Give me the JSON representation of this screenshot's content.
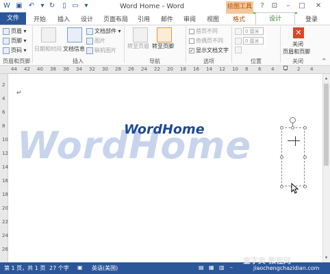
{
  "title": "Word Home - Word",
  "contextual_label": "绘图工具",
  "qat": {
    "save": "save-icon",
    "undo": "undo-icon",
    "redo": "redo-icon"
  },
  "tabs": [
    {
      "label": "文件"
    },
    {
      "label": "开始"
    },
    {
      "label": "插入"
    },
    {
      "label": "设计"
    },
    {
      "label": "页面布局"
    },
    {
      "label": "引用"
    },
    {
      "label": "邮件"
    },
    {
      "label": "审阅"
    },
    {
      "label": "视图"
    },
    {
      "label": "格式"
    },
    {
      "label": "设计"
    }
  ],
  "login": "登录",
  "ribbon": {
    "header_footer": {
      "header": "页眉",
      "footer": "页脚",
      "pagenum": "页码",
      "group": "页眉和页脚"
    },
    "insert": {
      "datetime": "日期和时间",
      "docinfo": "文档信息",
      "docparts": "文档部件",
      "picture": "图片",
      "online": "联机图片",
      "group": "插入"
    },
    "nav": {
      "goto_header": "转至页眉",
      "goto_footer": "转至页脚",
      "group": "导航"
    },
    "options": {
      "diff_first": "首页不同",
      "diff_odd": "奇偶页不同",
      "show_text": "显示文档文字",
      "group": "选项"
    },
    "position": {
      "top_val": "0 厘米",
      "bottom_val": "0 厘米",
      "group": "位置"
    },
    "close": {
      "label_line1": "关闭",
      "label_line2": "页眉和页脚",
      "group": "关闭"
    }
  },
  "ruler_ticks": [
    "44",
    "42",
    "40",
    "38",
    "36",
    "34",
    "32",
    "30",
    "28",
    "26",
    "24",
    "22",
    "20",
    "18",
    "16",
    "14",
    "12",
    "10",
    "8",
    "6",
    "4",
    "2",
    "2",
    "4"
  ],
  "vruler_ticks": [
    "2",
    "4",
    "6",
    "8",
    "10",
    "12",
    "14",
    "16",
    "18",
    "20",
    "22",
    "24",
    "26"
  ],
  "document": {
    "para_mark": "↵",
    "watermark": "WordHome",
    "logo": "WordHome"
  },
  "status": {
    "page": "第 1 页，共 1 页",
    "words": "27 个字",
    "lang": "英语(美国)"
  },
  "watermark_site": "jiaochengchazidian.com",
  "watermark_site_top": "查字典 教程网"
}
